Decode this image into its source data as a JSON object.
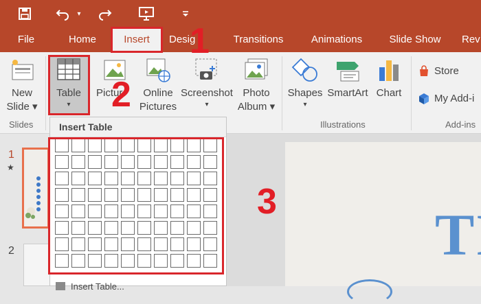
{
  "tabs": [
    {
      "label": "File"
    },
    {
      "label": "Home"
    },
    {
      "label": "Insert"
    },
    {
      "label": "Desig"
    },
    {
      "label": "Transitions"
    },
    {
      "label": "Animations"
    },
    {
      "label": "Slide Show"
    },
    {
      "label": "Rev"
    }
  ],
  "ribbon": {
    "new_slide": {
      "line1": "New",
      "line2": "Slide ▾"
    },
    "table": {
      "label": "Table",
      "arrow": "▾"
    },
    "pictures": {
      "label": "Pictur"
    },
    "online_pictures": {
      "line1": "Online",
      "line2": "Pictures"
    },
    "screenshot": {
      "label": "Screenshot",
      "arrow": "▾"
    },
    "photo_album": {
      "line1": "Photo",
      "line2": "Album ▾"
    },
    "shapes": {
      "label": "Shapes",
      "arrow": "▾"
    },
    "smartart": {
      "label": "SmartArt"
    },
    "chart": {
      "label": "Chart"
    },
    "store": {
      "label": "Store"
    },
    "my_addins": {
      "label": "My Add-i"
    },
    "groups": {
      "slides": "Slides",
      "illustrations": "Illustrations",
      "addins": "Add-ins"
    }
  },
  "dropdown": {
    "title": "Insert Table",
    "bottom_item": "Insert Table..."
  },
  "slides": {
    "thumb1_number": "1",
    "thumb1_star": "★",
    "thumb2_number": "2"
  },
  "slide_preview": {
    "title_fragment": "TI"
  },
  "annotations": {
    "step1": "1",
    "step2": "2",
    "step3": "3"
  },
  "colors": {
    "accent": "#b7472a",
    "annotation_red": "#d9262b"
  }
}
